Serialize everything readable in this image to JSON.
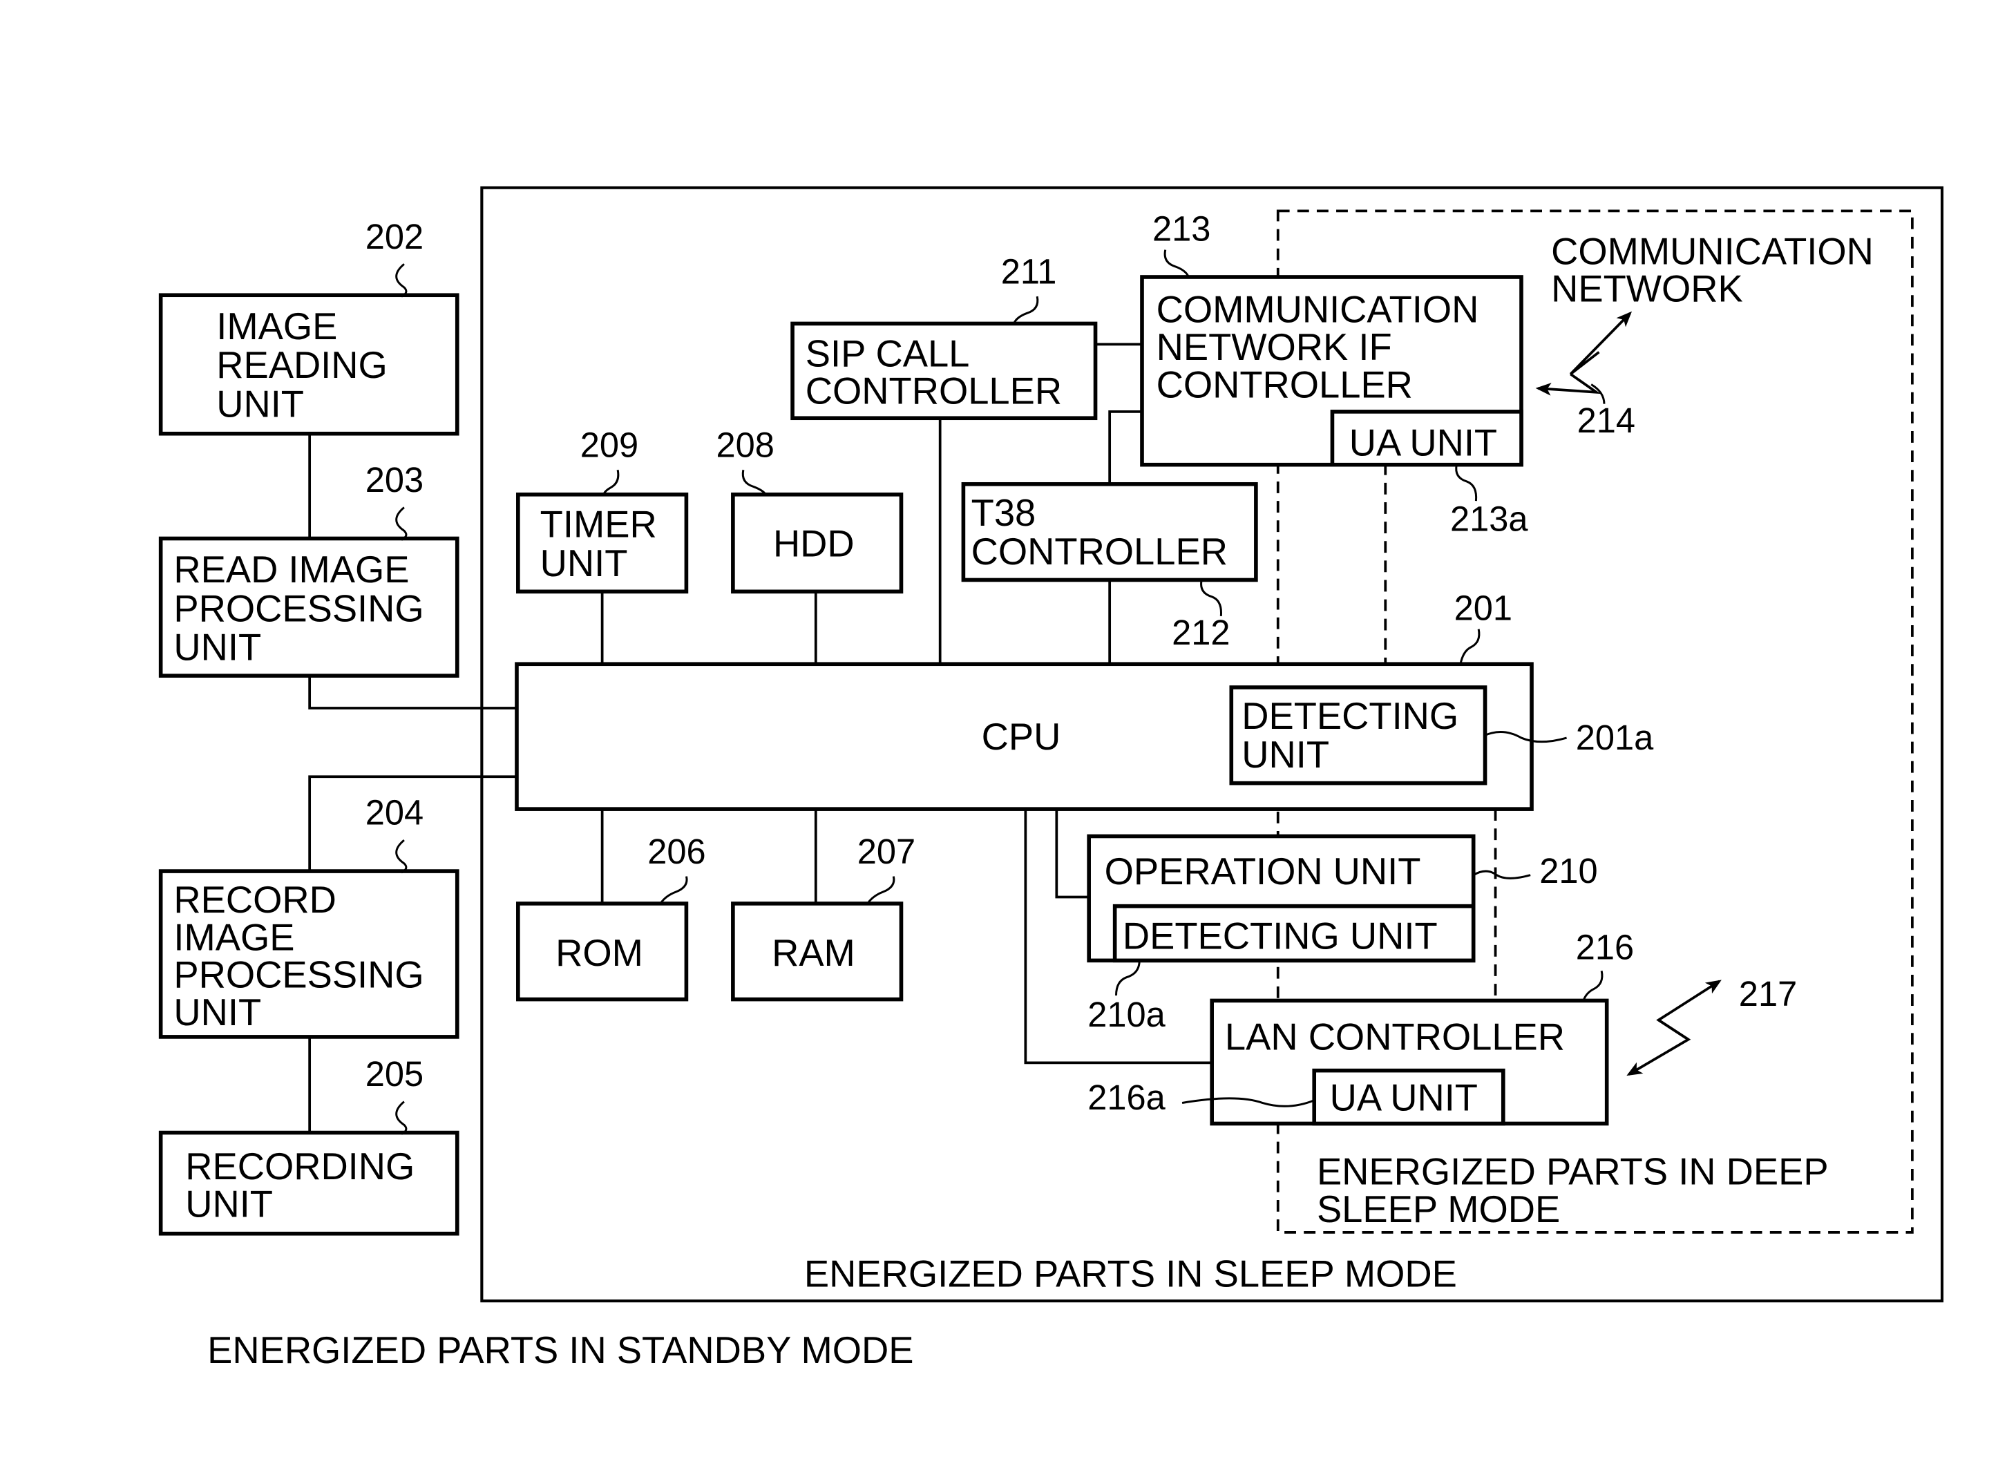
{
  "diagram": {
    "regions": {
      "standby": "ENERGIZED PARTS IN STANDBY MODE",
      "sleep": "ENERGIZED PARTS IN SLEEP MODE",
      "deep_sleep": [
        "ENERGIZED PARTS IN DEEP",
        "SLEEP MODE"
      ]
    },
    "blocks": {
      "image_reading": {
        "ref": "202",
        "lines": [
          "IMAGE",
          "READING",
          "UNIT"
        ]
      },
      "read_image_processing": {
        "ref": "203",
        "lines": [
          "READ IMAGE",
          "PROCESSING",
          "UNIT"
        ]
      },
      "record_image_processing": {
        "ref": "204",
        "lines": [
          "RECORD",
          "IMAGE",
          "PROCESSING",
          "UNIT"
        ]
      },
      "recording": {
        "ref": "205",
        "lines": [
          "RECORDING",
          "UNIT"
        ]
      },
      "cpu": {
        "ref": "201",
        "label": "CPU"
      },
      "cpu_detecting": {
        "ref": "201a",
        "lines": [
          "DETECTING",
          "UNIT"
        ]
      },
      "rom": {
        "ref": "206",
        "label": "ROM"
      },
      "ram": {
        "ref": "207",
        "label": "RAM"
      },
      "hdd": {
        "ref": "208",
        "label": "HDD"
      },
      "timer": {
        "ref": "209",
        "lines": [
          "TIMER",
          "UNIT"
        ]
      },
      "operation": {
        "ref": "210",
        "label": "OPERATION UNIT"
      },
      "operation_detecting": {
        "ref": "210a",
        "label": "DETECTING UNIT"
      },
      "sip_call": {
        "ref": "211",
        "lines": [
          "SIP CALL",
          "CONTROLLER"
        ]
      },
      "t38": {
        "ref": "212",
        "lines": [
          "T38",
          "CONTROLLER"
        ]
      },
      "comm_if": {
        "ref": "213",
        "lines": [
          "COMMUNICATION",
          "NETWORK IF",
          "CONTROLLER"
        ]
      },
      "comm_ua": {
        "ref": "213a",
        "label": "UA UNIT"
      },
      "lan": {
        "ref": "216",
        "label": "LAN CONTROLLER"
      },
      "lan_ua": {
        "ref": "216a",
        "label": "UA UNIT"
      }
    },
    "links": {
      "comm_network": {
        "ref": "214",
        "lines": [
          "COMMUNICATION",
          "NETWORK"
        ]
      },
      "lan_link": {
        "ref": "217"
      }
    }
  }
}
